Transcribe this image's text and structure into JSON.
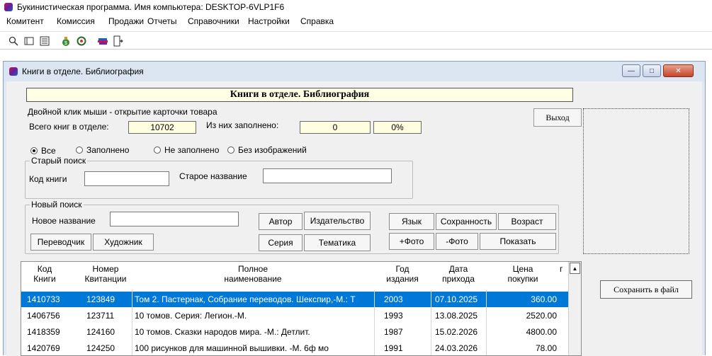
{
  "app": {
    "title": "Букинистическая программа. Имя компьютера: DESKTOP-6VLP1F6",
    "menu": [
      "Комитент",
      "Комиссия",
      "Продажи",
      "Отчеты",
      "Справочники",
      "Настройки",
      "Справка"
    ],
    "toolbar_icons": [
      "find-icon",
      "card-icon",
      "list-icon",
      "money-bag-icon",
      "refresh-icon",
      "books-icon",
      "exit-door-icon"
    ]
  },
  "window": {
    "title": "Книги в отделе. Библиография",
    "heading": "Книги в отделе. Библиография",
    "hint": "Двойной клик мыши - открытие карточки товара",
    "total_label": "Всего книг в отделе:",
    "total_value": "10702",
    "filled_label": "Из них заполнено:",
    "filled_value": "0",
    "filled_percent": "0%",
    "exit_button": "Выход",
    "save_button": "Сохранить в файл"
  },
  "filters": {
    "options": [
      "Все",
      "Заполнено",
      "Не заполнено",
      "Без изображений"
    ],
    "selected": "Все"
  },
  "old_search": {
    "legend": "Старый поиск",
    "code_label": "Код книги",
    "code_value": "",
    "old_name_label": "Старое название",
    "old_name_value": ""
  },
  "new_search": {
    "legend": "Новый поиск",
    "name_label": "Новое название",
    "name_value": "",
    "buttons": {
      "author": "Автор",
      "publisher": "Издательство",
      "language": "Язык",
      "condition": "Сохранность",
      "age": "Возраст",
      "translator": "Переводчик",
      "artist": "Художник",
      "series": "Серия",
      "topic": "Тематика",
      "add_photo": "+Фото",
      "remove_photo": "-Фото",
      "show": "Показать"
    }
  },
  "grid": {
    "columns": [
      [
        "Код",
        "Книги"
      ],
      [
        "Номер",
        "Квитанции"
      ],
      [
        "Полное",
        "наименование"
      ],
      [
        "Год",
        "издания"
      ],
      [
        "Дата",
        "прихода"
      ],
      [
        "Цена",
        "покупки"
      ],
      [
        "",
        "г"
      ]
    ],
    "rows": [
      {
        "code": "1410733",
        "receipt": "123849",
        "name": "Том 2. Пастернак, Собрание переводов. Шекспир,-М.: Т",
        "year": "2003",
        "date": "07.10.2025",
        "price": "360.00",
        "selected": true
      },
      {
        "code": "1406756",
        "receipt": "123711",
        "name": "10 томов. Серия: Легион.-М.",
        "year": "1993",
        "date": "13.08.2025",
        "price": "2520.00",
        "selected": false
      },
      {
        "code": "1418359",
        "receipt": "124160",
        "name": "10 томов. Сказки народов мира. -М.: Детлит.",
        "year": "1987",
        "date": "15.02.2026",
        "price": "4800.00",
        "selected": false
      },
      {
        "code": "1420769",
        "receipt": "124250",
        "name": "100 рисунков для машинной вышивки. -М. 6ф мо",
        "year": "1991",
        "date": "24.03.2026",
        "price": "78.00",
        "selected": false
      }
    ]
  }
}
